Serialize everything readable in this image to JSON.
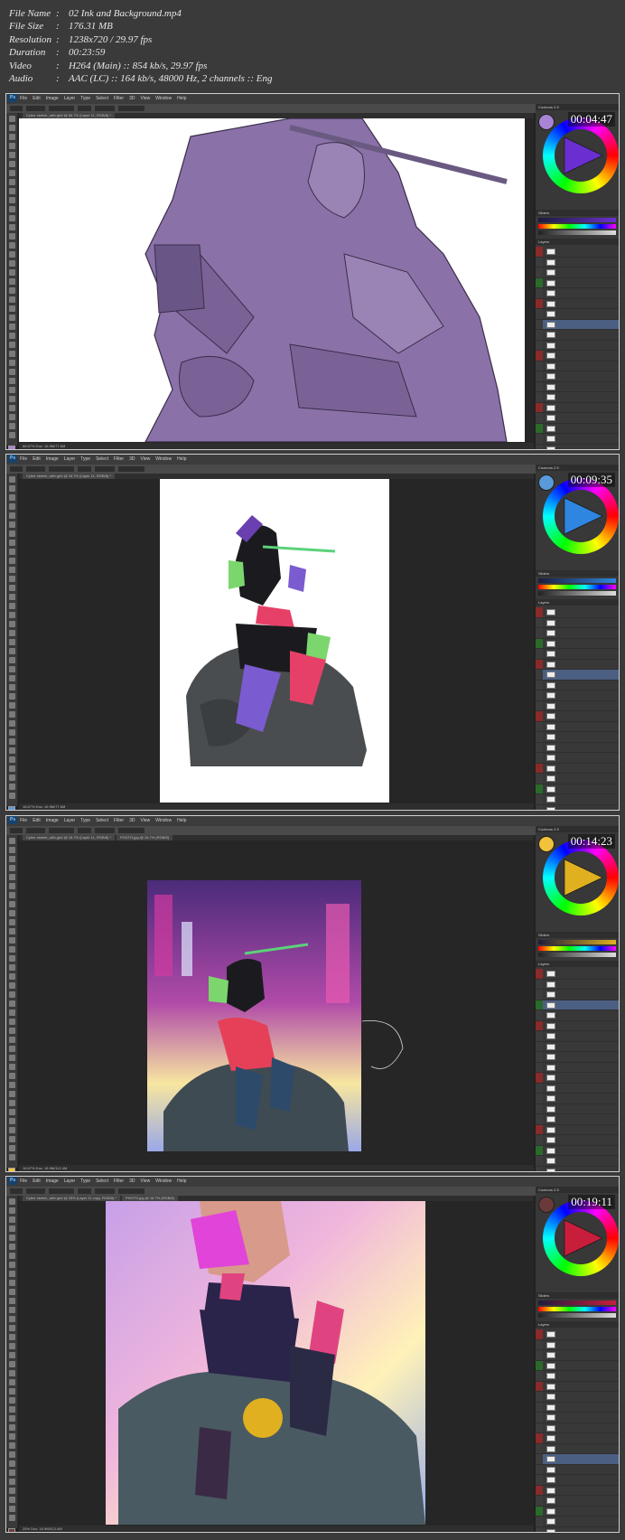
{
  "info": [
    {
      "key": "File Name",
      "value": "02 Ink and Background.mp4"
    },
    {
      "key": "File Size",
      "value": "176.31 MB"
    },
    {
      "key": "Resolution",
      "value": "1238x720 / 29.97 fps"
    },
    {
      "key": "Duration",
      "value": "00:23:59"
    },
    {
      "key": "Video",
      "value": "H264 (Main) :: 854 kb/s, 29.97 fps"
    },
    {
      "key": "Audio",
      "value": "AAC (LC) :: 164 kb/s, 48000 Hz, 2 channels :: Eng"
    }
  ],
  "info_separator": ":",
  "ps": {
    "logo": "Ps",
    "menu": [
      "File",
      "Edit",
      "Image",
      "Layer",
      "Type",
      "Select",
      "Filter",
      "3D",
      "View",
      "Window",
      "Help"
    ],
    "panel_heads": [
      "Coolorus 2.5",
      "Sliders",
      "Layers"
    ]
  },
  "frames": [
    {
      "timecode": "00:04:47",
      "doc_tabs": [
        "Cyber sketch_with grid @ 66.7% (Layer 11, RGB/8) *"
      ],
      "status": "66.67%   Doc: 16.9M/77.6M",
      "wheel_fg": "#a884d6",
      "tri_color": "#6b2fd1",
      "art": "lineart"
    },
    {
      "timecode": "00:09:35",
      "doc_tabs": [
        "Cyber sketch_with grid @ 16.7% (Layer 11, RGB/8) *"
      ],
      "status": "16.67%   Doc: 16.9M/77.6M",
      "wheel_fg": "#5a9ad8",
      "tri_color": "#2f86e0",
      "art": "flats"
    },
    {
      "timecode": "00:14:23",
      "doc_tabs": [
        "Cyber sketch_with grid @ 16.7% (Layer 11, RGB/8) *",
        "PHOTO.jpg @ 16.7% (RGB/8)"
      ],
      "status": "16.67%   Doc: 16.9M/112.4M",
      "wheel_fg": "#f2c23a",
      "tri_color": "#e0b020",
      "art": "background"
    },
    {
      "timecode": "00:19:11",
      "doc_tabs": [
        "Cyber sketch_with grid @ 25% (Layer 11 copy, RGB/8) *",
        "PHOTO.jpg @ 16.7% (RGB/8)"
      ],
      "status": "25%   Doc: 16.9M/112.4M",
      "wheel_fg": "#6a3a3a",
      "tri_color": "#c81e3c",
      "art": "render"
    }
  ],
  "colors": {
    "frame_border": "#cfcfcf",
    "workspace": "#262626",
    "panel": "#383838",
    "selected_layer": "#4b5f83"
  }
}
